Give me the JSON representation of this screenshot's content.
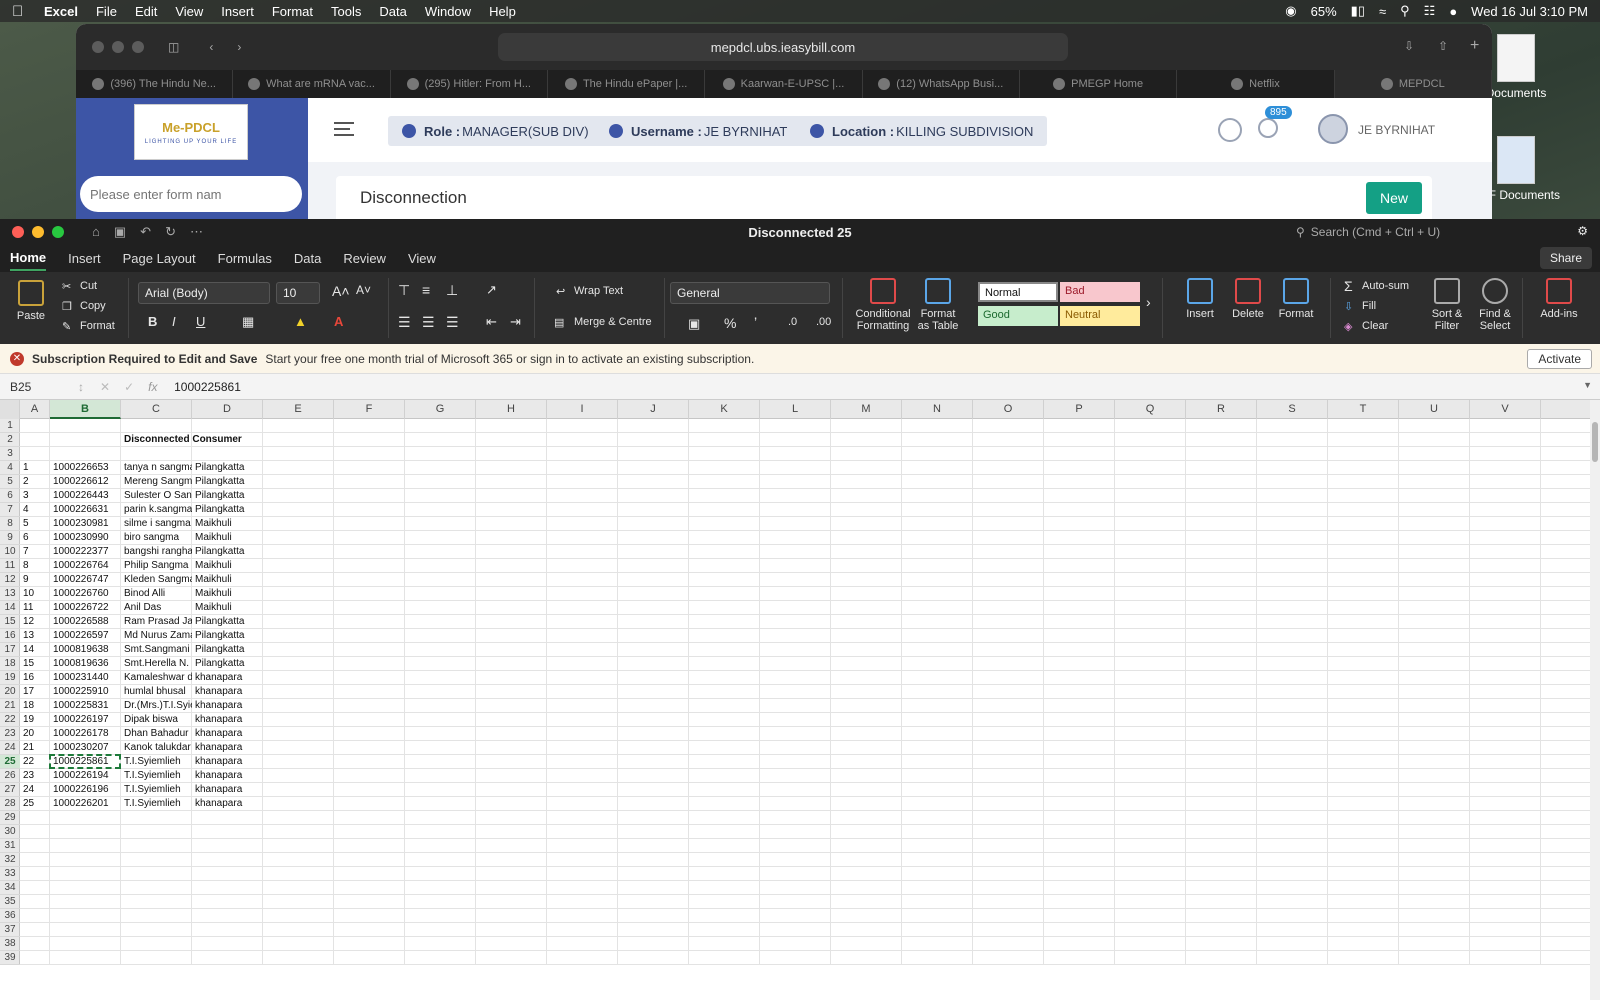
{
  "menubar": {
    "app": "Excel",
    "items": [
      "File",
      "Edit",
      "View",
      "Insert",
      "Format",
      "Tools",
      "Data",
      "Window",
      "Help"
    ],
    "battery": "65%",
    "datetime": "Wed 16 Jul  3:10 PM"
  },
  "browser": {
    "url": "mepdcl.ubs.ieasybill.com",
    "tabs": [
      "(396) The Hindu Ne...",
      "What are mRNA vac...",
      "(295) Hitler: From H...",
      "The Hindu ePaper |...",
      "Kaarwan-E-UPSC |...",
      "(12) WhatsApp Busi...",
      "PMEGP Home",
      "Netflix",
      "MEPDCL"
    ],
    "site": {
      "logo_text": "Me-PDCL",
      "logo_tagline": "LIGHTING UP YOUR LIFE",
      "form_search_placeholder": "Please enter form nam",
      "role_label": "Role :",
      "role_value": "MANAGER(SUB DIV)",
      "username_label": "Username :",
      "username_value": "JE BYRNIHAT",
      "location_label": "Location :",
      "location_value": "KILLING SUBDIVISION",
      "notification_count": "895",
      "user_name": "JE BYRNIHAT",
      "page_heading": "Disconnection",
      "new_button": "New"
    }
  },
  "desktop": {
    "icons": [
      "Documents",
      "PDF Documents"
    ]
  },
  "excel": {
    "window_title": "Disconnected 25",
    "search_placeholder": "Search (Cmd + Ctrl + U)",
    "ribbon_tabs": [
      "Home",
      "Insert",
      "Page Layout",
      "Formulas",
      "Data",
      "Review",
      "View"
    ],
    "share": "Share",
    "ribbon": {
      "paste": "Paste",
      "cut": "Cut",
      "copy": "Copy",
      "format_painter": "Format",
      "font": "Arial (Body)",
      "size": "10",
      "bold": "B",
      "italic": "I",
      "underline": "U",
      "wrap_text": "Wrap Text",
      "merge": "Merge & Centre",
      "number_format": "General",
      "percent": "%",
      "conditional": "Conditional Formatting",
      "format_table": "Format as Table",
      "styles": {
        "normal": "Normal",
        "bad": "Bad",
        "good": "Good",
        "neutral": "Neutral"
      },
      "insert": "Insert",
      "delete": "Delete",
      "format": "Format",
      "autosum": "Auto-sum",
      "fill": "Fill",
      "clear": "Clear",
      "sort_filter": "Sort & Filter",
      "find_select": "Find & Select",
      "addins": "Add-ins"
    },
    "subscription": {
      "title": "Subscription Required to Edit and Save",
      "message": "Start your free one month trial of Microsoft 365 or sign in to activate an existing subscription.",
      "button": "Activate"
    },
    "formula_bar": {
      "name_box": "B25",
      "fx": "fx",
      "value": "1000225861"
    },
    "columns": [
      "A",
      "B",
      "C",
      "D",
      "E",
      "F",
      "G",
      "H",
      "I",
      "J",
      "K",
      "L",
      "M",
      "N",
      "O",
      "P",
      "Q",
      "R",
      "S",
      "T",
      "U",
      "V"
    ],
    "row_numbers": [
      "1",
      "2",
      "3",
      "4",
      "5",
      "6",
      "7",
      "8",
      "9",
      "10",
      "11",
      "12",
      "13",
      "14",
      "15",
      "16",
      "17",
      "18",
      "19",
      "20",
      "21",
      "22",
      "23",
      "24",
      "25",
      "26",
      "27",
      "28",
      "29",
      "30",
      "31",
      "32",
      "33",
      "34",
      "35",
      "36",
      "37",
      "38",
      "39"
    ],
    "heading": "Disconnected Consumer",
    "rows": [
      [
        "1",
        "1000226653",
        "tanya n sangma",
        "Pilangkatta"
      ],
      [
        "2",
        "1000226612",
        "Mereng Sangma",
        "Pilangkatta"
      ],
      [
        "3",
        "1000226443",
        "Sulester O Sangma",
        "Pilangkatta"
      ],
      [
        "4",
        "1000226631",
        "parin k.sangma",
        "Pilangkatta"
      ],
      [
        "5",
        "1000230981",
        "silme i sangma",
        "Maikhuli"
      ],
      [
        "6",
        "1000230990",
        "biro sangma",
        "Maikhuli"
      ],
      [
        "7",
        "1000222377",
        "bangshi rangha",
        "Pilangkatta"
      ],
      [
        "8",
        "1000226764",
        "Philip Sangma",
        "Maikhuli"
      ],
      [
        "9",
        "1000226747",
        "Kleden Sangma",
        "Maikhuli"
      ],
      [
        "10",
        "1000226760",
        "Binod Alli",
        "Maikhuli"
      ],
      [
        "11",
        "1000226722",
        "Anil Das",
        "Maikhuli"
      ],
      [
        "12",
        "1000226588",
        "Ram Prasad Jai",
        "Pilangkatta"
      ],
      [
        "13",
        "1000226597",
        "Md Nurus Zaman",
        "Pilangkatta"
      ],
      [
        "14",
        "1000819638",
        "Smt.Sangmani I",
        "Pilangkatta"
      ],
      [
        "15",
        "1000819636",
        "Smt.Herella N. S",
        "Pilangkatta"
      ],
      [
        "16",
        "1000231440",
        "Kamaleshwar de",
        "khanapara"
      ],
      [
        "17",
        "1000225910",
        "humlal bhusal",
        "khanapara"
      ],
      [
        "18",
        "1000225831",
        "Dr.(Mrs.)T.I.Syie",
        "khanapara"
      ],
      [
        "19",
        "1000226197",
        "Dipak biswa",
        "khanapara"
      ],
      [
        "20",
        "1000226178",
        "Dhan Bahadur I",
        "khanapara"
      ],
      [
        "21",
        "1000230207",
        "Kanok talukdar",
        "khanapara"
      ],
      [
        "22",
        "1000225861",
        "T.I.Syiemlieh",
        "khanapara"
      ],
      [
        "23",
        "1000226194",
        "T.I.Syiemlieh",
        "khanapara"
      ],
      [
        "24",
        "1000226196",
        "T.I.Syiemlieh",
        "khanapara"
      ],
      [
        "25",
        "1000226201",
        "T.I.Syiemlieh",
        "khanapara"
      ]
    ]
  }
}
